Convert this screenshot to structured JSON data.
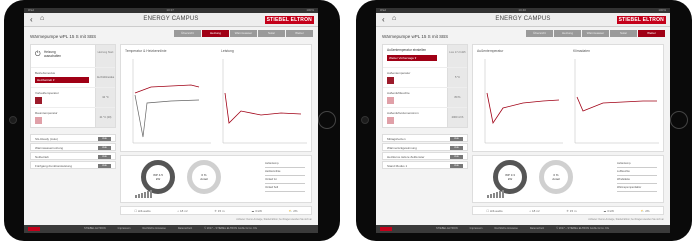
{
  "tablets": [
    {
      "status_left": "iPad",
      "status_time": "10:37",
      "status_right": "100%",
      "nav": {
        "back": "‹",
        "home": "⌂",
        "title": "ENERGY CAMPUS",
        "logo": "STIEBEL ELTRON"
      },
      "page_title": "Wärmepumpe wPL 15 S mit SBS",
      "tabs": [
        "Übersicht",
        "Heizung",
        "Warmwasser",
        "Solar",
        "Wetter"
      ],
      "active_tab": 1,
      "heat_card": {
        "label_line1": "Heizung",
        "label_line2": "ausschalten",
        "side": "Heizung Start"
      },
      "rows": [
        {
          "label": "Betriebsmodus",
          "control": "Heizbetrieb ▾",
          "val": "AH Kühlmodus"
        },
        {
          "label": "Vorlauftemperatur",
          "val": "34 °C"
        },
        {
          "label": "Raumtemperatur",
          "val": "21 °C (20)"
        }
      ],
      "toggles": [
        {
          "label": "SG-Ready (Auto)",
          "btn": "Aus"
        },
        {
          "label": "Warmwassernutzung",
          "btn": "Aus"
        },
        {
          "label": "Notbetrieb",
          "btn": "Aus"
        },
        {
          "label": "Fünfgang-Funktionsleistung",
          "btn": "Aus"
        }
      ],
      "chart_titles": [
        "Temperatur & Heizkennlinie",
        "Leistung"
      ],
      "gauge1": {
        "line1": "WP 4.5",
        "line2": "kW"
      },
      "gauge2": {
        "line1": "0 %",
        "line2": "Anteil"
      },
      "legend": [
        "Außentemp.",
        "Heizkennlinie",
        "Vorlauf Ist",
        "Vorlauf Soll"
      ],
      "icons": [
        "☐ Hifi-audio",
        "⌂ 18 m²",
        "✈ 15 m",
        "☁ 3 kW",
        "⛅ 2%"
      ],
      "footnote": "Anbieter: Demo-Anzeige, Stiebel Eltron; bei Fragen wenden Sie sich an",
      "footer": [
        "STIEBEL ELTRON",
        "Impressum",
        "Rechtliche Hinweise",
        "Datenschutz",
        "© 2017 – STIEBEL ELTRON GmbH & Co. KG"
      ]
    },
    {
      "status_left": "iPad",
      "status_time": "10:40",
      "status_right": "100%",
      "nav": {
        "back": "‹",
        "home": "⌂",
        "title": "ENERGY CAMPUS",
        "logo": "STIEBEL ELTRON"
      },
      "page_title": "Wärmepumpe wPL 15 S mit SBS",
      "tabs": [
        "Übersicht",
        "Heizung",
        "Warmwasser",
        "Solar",
        "Wetter"
      ],
      "active_tab": 4,
      "heat_card": {
        "label_line1": "Außentemperatur einstellen",
        "label_line2": "Wetter Vorhersage ▾",
        "side": "Live 17.2 kWh"
      },
      "rows": [
        {
          "label": "Außentemperatur",
          "val": "5 °C"
        },
        {
          "label": "Außenluftfeuchte",
          "val": "80 %"
        },
        {
          "label": "Außenluftvolumenstrom",
          "val": "2000 m³/h"
        }
      ],
      "toggles": [
        {
          "label": "Mittagsheizen",
          "btn": "Aus"
        },
        {
          "label": "Wärmerückgewinnung",
          "btn": "Aus"
        },
        {
          "label": "Heizkurve tiefere Zeitfenster",
          "btn": "Aus"
        },
        {
          "label": "Stand Modus 1",
          "btn": "Aus"
        }
      ],
      "chart_titles": [
        "Außentemperatur",
        "Klimadaten"
      ],
      "gauge1": {
        "line1": "WP 3.3",
        "line2": "kW"
      },
      "gauge2": {
        "line1": "0 %",
        "line2": "Anteil"
      },
      "legend": [
        "Außentemp.",
        "Luftfeuchte",
        "Windstärke",
        "Wärmepumpenfaktor"
      ],
      "icons": [
        "☐ Hifi-audio",
        "⌂ 18 m²",
        "✈ 15 m",
        "☁ 3 kW",
        "⛅ 2%"
      ],
      "footnote": "Anbieter: Demo-Anzeige, Stiebel Eltron; bei Fragen wenden Sie sich an",
      "footer": [
        "STIEBEL ELTRON",
        "Impressum",
        "Rechtliche Hinweise",
        "Datenschutz",
        "© 2017 – STIEBEL ELTRON GmbH & Co. KG"
      ]
    }
  ]
}
